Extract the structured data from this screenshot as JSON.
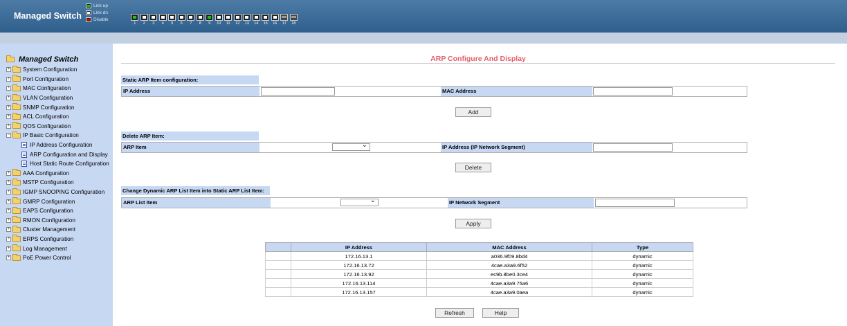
{
  "header": {
    "brand": "Managed Switch",
    "legend": {
      "link_up": "Link up",
      "link_dn": "Link dn",
      "disable": "Disable"
    },
    "ports": [
      {
        "num": "1",
        "state": "link"
      },
      {
        "num": "2",
        "state": "down"
      },
      {
        "num": "3",
        "state": "down"
      },
      {
        "num": "4",
        "state": "down"
      },
      {
        "num": "5",
        "state": "down"
      },
      {
        "num": "6",
        "state": "down"
      },
      {
        "num": "7",
        "state": "down"
      },
      {
        "num": "8",
        "state": "down"
      },
      {
        "num": "9",
        "state": "link"
      },
      {
        "num": "10",
        "state": "down"
      },
      {
        "num": "11",
        "state": "down"
      },
      {
        "num": "12",
        "state": "down"
      },
      {
        "num": "13",
        "state": "down"
      },
      {
        "num": "14",
        "state": "down"
      },
      {
        "num": "15",
        "state": "down"
      },
      {
        "num": "16",
        "state": "down"
      },
      {
        "num": "17",
        "state": "sfp"
      },
      {
        "num": "18",
        "state": "sfp"
      }
    ]
  },
  "sidebar": {
    "title": "Managed Switch",
    "items": [
      {
        "label": "System Configuration",
        "type": "folder"
      },
      {
        "label": "Port Configuration",
        "type": "folder"
      },
      {
        "label": "MAC Configuration",
        "type": "folder"
      },
      {
        "label": "VLAN Configuration",
        "type": "folder"
      },
      {
        "label": "SNMP Configuration",
        "type": "folder"
      },
      {
        "label": "ACL Configuration",
        "type": "folder"
      },
      {
        "label": "QOS Configuration",
        "type": "folder"
      },
      {
        "label": "IP Basic Configuration",
        "type": "folder-open"
      },
      {
        "label": "IP Address Configuration",
        "type": "doc"
      },
      {
        "label": "ARP Configuration and Display",
        "type": "doc"
      },
      {
        "label": "Host Static Route Configuration",
        "type": "doc"
      },
      {
        "label": "AAA Configuration",
        "type": "folder"
      },
      {
        "label": "MSTP Configuration",
        "type": "folder"
      },
      {
        "label": "IGMP SNOOPING Configuration",
        "type": "folder"
      },
      {
        "label": "GMRP Configuration",
        "type": "folder"
      },
      {
        "label": "EAPS Configuration",
        "type": "folder"
      },
      {
        "label": "RMON Configuration",
        "type": "folder"
      },
      {
        "label": "Cluster Management",
        "type": "folder"
      },
      {
        "label": "ERPS Configuration",
        "type": "folder"
      },
      {
        "label": "Log Management",
        "type": "folder"
      },
      {
        "label": "PoE Power Control",
        "type": "folder"
      }
    ]
  },
  "main": {
    "title": "ARP Configure And Display",
    "static": {
      "header": "Static ARP Item configuration:",
      "ip_label": "IP Address",
      "mac_label": "MAC Address",
      "ip_value": "",
      "mac_value": "",
      "add_button": "Add"
    },
    "delete": {
      "header": "Delete ARP Item:",
      "item_label": "ARP Item",
      "item_value": "",
      "ip_label": "IP Address (IP Network Segment)",
      "ip_value": "",
      "delete_button": "Delete"
    },
    "change": {
      "header": "Change Dynamic ARP List Item into Static ARP List Item:",
      "list_label": "ARP List Item",
      "list_value": "",
      "segment_label": "IP Network Segment",
      "segment_value": "",
      "apply_button": "Apply"
    },
    "table": {
      "headers": [
        "",
        "IP Address",
        "MAC Address",
        "Type"
      ],
      "rows": [
        [
          "",
          "172.16.13.1",
          "a036.9f09.8bd4",
          "dynamic"
        ],
        [
          "",
          "172.16.13.72",
          "4cae.a3a9.6f52",
          "dynamic"
        ],
        [
          "",
          "172.16.13.92",
          "ec9b.8be0.3ce4",
          "dynamic"
        ],
        [
          "",
          "172.16.13.114",
          "4cae.a3a9.75a6",
          "dynamic"
        ],
        [
          "",
          "172.16.13.157",
          "4cae.a3a9.0aea",
          "dynamic"
        ]
      ]
    },
    "refresh_button": "Refresh",
    "help_button": "Help"
  }
}
